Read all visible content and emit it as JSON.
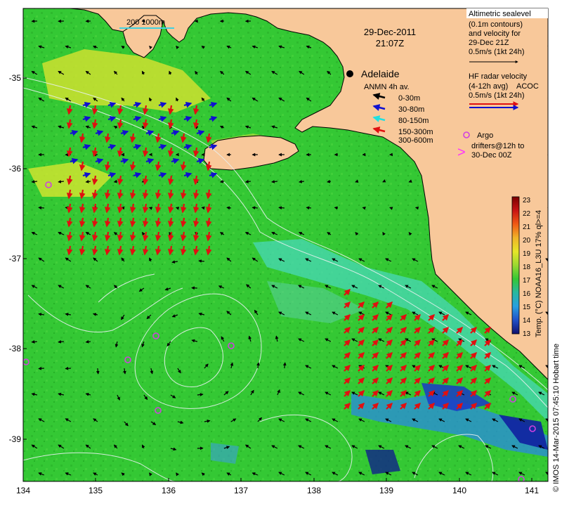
{
  "map": {
    "date": "29-Dec-2011",
    "time": "21:07Z",
    "place_label": "Adelaide",
    "scale_label": "200  1000m",
    "x_ticks": [
      "134",
      "135",
      "136",
      "137",
      "138",
      "139",
      "140",
      "141"
    ],
    "y_ticks": [
      "-35",
      "-36",
      "-37",
      "-38",
      "-39"
    ],
    "legend_anmn": {
      "title": "ANMN 4h av.",
      "items": [
        {
          "label": "0-30m",
          "color": "#000000"
        },
        {
          "label": "30-80m",
          "color": "#1010d0"
        },
        {
          "label": "80-150m",
          "color": "#20e0e0"
        },
        {
          "label": "150-300m",
          "color": "#e01010"
        },
        {
          "label": "300-600m",
          "color": "#ff40ff"
        }
      ]
    },
    "legend_altimetric": {
      "lines": [
        "Altimetric sealevel",
        "(0.1m contours)",
        "and velocity for",
        "29-Dec 21Z",
        "0.5m/s (1kt 24h)"
      ]
    },
    "legend_hf": {
      "lines": [
        "HF radar velocity",
        "(4-12h avg)",
        "0.5m/s (1kt 24h)"
      ],
      "overlap_text": "ACOC"
    },
    "legend_argo": {
      "lines": [
        "Argo",
        "drifters@12h to",
        "30-Dec 00Z"
      ]
    },
    "colorbar": {
      "ticks": [
        "23",
        "22",
        "21",
        "20",
        "19",
        "18",
        "17",
        "16",
        "15",
        "14",
        "13"
      ],
      "label": "Temp. (°C) NOAA16_L3U 17% ql>=4"
    },
    "credit": "© IMOS 14-Mar-2015 07:45:10 Hobart time",
    "colors": {
      "land": "#f8c89a",
      "sea_green": "#34c834",
      "sea_light": "#5ad248",
      "shelf_cyan": "#44d8c0",
      "deep_blue": "#2a5ad8",
      "yellow": "#e6e628",
      "argo": "#d040e0",
      "hf_red": "#e01010",
      "hf_blue": "#1010d0"
    }
  }
}
